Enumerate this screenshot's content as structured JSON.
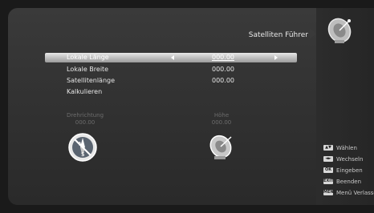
{
  "header": {
    "title": "Satelliten Führer",
    "icon": "satellite-dish-icon"
  },
  "form": {
    "rows": [
      {
        "label": "Lokale Länge",
        "value": "000.00"
      },
      {
        "label": "Lokale Breite",
        "value": "000.00"
      },
      {
        "label": "Satellitenlänge",
        "value": "000.00"
      },
      {
        "label": "Kalkulieren",
        "value": ""
      }
    ]
  },
  "indicators": {
    "direction": {
      "label": "Drehrichtung",
      "value": "000.00",
      "icon": "compass-icon"
    },
    "elevation": {
      "label": "Höhe",
      "value": "000.00",
      "icon": "satellite-dish-icon"
    }
  },
  "legend": {
    "items": [
      {
        "key": "▲▼",
        "label": "Wählen"
      },
      {
        "key": "◄►",
        "label": "Wechseln"
      },
      {
        "key": "OK",
        "label": "Eingeben"
      },
      {
        "key": "EXIT",
        "label": "Beenden"
      },
      {
        "key": "MENU",
        "label": "Menü Verlassen"
      }
    ]
  },
  "colors": {
    "panel": "#323232",
    "sidebar": "#262626",
    "highlight": "#d0d0d0",
    "text": "#e6e6e6"
  }
}
